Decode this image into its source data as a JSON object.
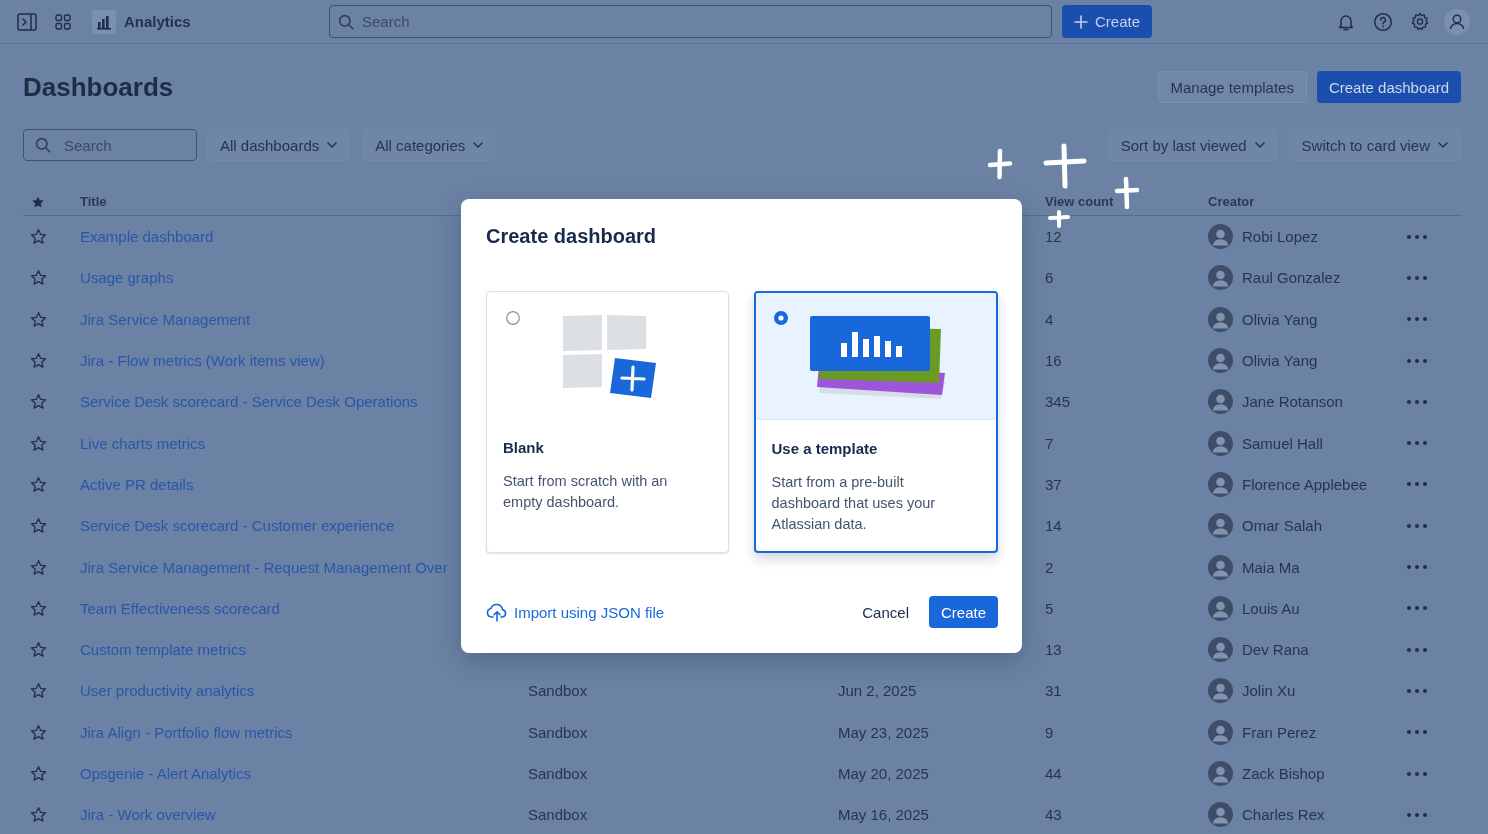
{
  "top_bar": {
    "app_name": "Analytics",
    "search": {
      "placeholder": "Search"
    },
    "create_button": "Create"
  },
  "header": {
    "title": "Dashboards",
    "buttons": [
      {
        "label": "Manage templates",
        "kind": "default"
      },
      {
        "label": "Create dashboard",
        "kind": "primary"
      }
    ]
  },
  "filters": {
    "search": {
      "placeholder": "Search"
    },
    "dropdowns_left": [
      "All dashboards",
      "All categories"
    ],
    "dropdowns_right": [
      "Sort by last viewed",
      "Switch to card view"
    ]
  },
  "table": {
    "columns": {
      "title": "Title",
      "view_count": "View count",
      "creator": "Creator"
    },
    "rows": [
      {
        "starred": false,
        "title": "Example dashboard",
        "view_count": "12",
        "creator": "Robi Lopez"
      },
      {
        "starred": false,
        "title": "Usage graphs",
        "view_count": "6",
        "creator": "Raul Gonzalez"
      },
      {
        "starred": false,
        "title": "Jira Service Management",
        "view_count": "4",
        "creator": "Olivia Yang"
      },
      {
        "starred": false,
        "title": "Jira - Flow metrics (Work items view)",
        "view_count": "16",
        "creator": "Olivia Yang"
      },
      {
        "starred": false,
        "title": "Service Desk scorecard - Service Desk Operations",
        "view_count": "345",
        "creator": "Jane Rotanson"
      },
      {
        "starred": false,
        "title": "Live charts metrics",
        "view_count": "7",
        "creator": "Samuel Hall"
      },
      {
        "starred": false,
        "title": "Active PR details",
        "view_count": "37",
        "creator": "Florence Applebee"
      },
      {
        "starred": false,
        "title": "Service Desk scorecard - Customer experience",
        "view_count": "14",
        "creator": "Omar Salah"
      },
      {
        "starred": false,
        "title": "Jira Service Management - Request Management Over",
        "view_count": "2",
        "creator": "Maia Ma"
      },
      {
        "starred": false,
        "title": "Team Effectiveness scorecard",
        "view_count": "5",
        "creator": "Louis Au"
      },
      {
        "starred": false,
        "title": "Custom template metrics",
        "view_count": "13",
        "creator": "Dev Rana"
      },
      {
        "starred": false,
        "title": "User productivity analytics",
        "column_3": "Sandbox",
        "column_4": "Jun 2, 2025",
        "view_count": "31",
        "creator": "Jolin Xu"
      },
      {
        "starred": false,
        "title": "Jira Align - Portfolio flow metrics",
        "column_3": "Sandbox",
        "column_4": "May 23, 2025",
        "view_count": "9",
        "creator": "Fran Perez"
      },
      {
        "starred": false,
        "title": "Opsgenie - Alert Analytics",
        "column_3": "Sandbox",
        "column_4": "May 20, 2025",
        "view_count": "44",
        "creator": "Zack Bishop"
      },
      {
        "starred": false,
        "title": "Jira - Work overview",
        "column_3": "Sandbox",
        "column_4": "May 16, 2025",
        "view_count": "43",
        "creator": "Charles Rex"
      }
    ]
  },
  "dialog": {
    "title": "Create dashboard",
    "options": [
      {
        "kind": "blank",
        "title": "Blank",
        "description": "Start from scratch with an empty dashboard.",
        "selected": false
      },
      {
        "kind": "template",
        "title": "Use a template",
        "description": "Start from a pre-built dashboard that uses your Atlassian data.",
        "selected": true
      }
    ],
    "import_link": "Import using JSON file",
    "buttons": [
      {
        "label": "Cancel",
        "kind": "subtle"
      },
      {
        "label": "Create",
        "kind": "primary"
      }
    ]
  }
}
